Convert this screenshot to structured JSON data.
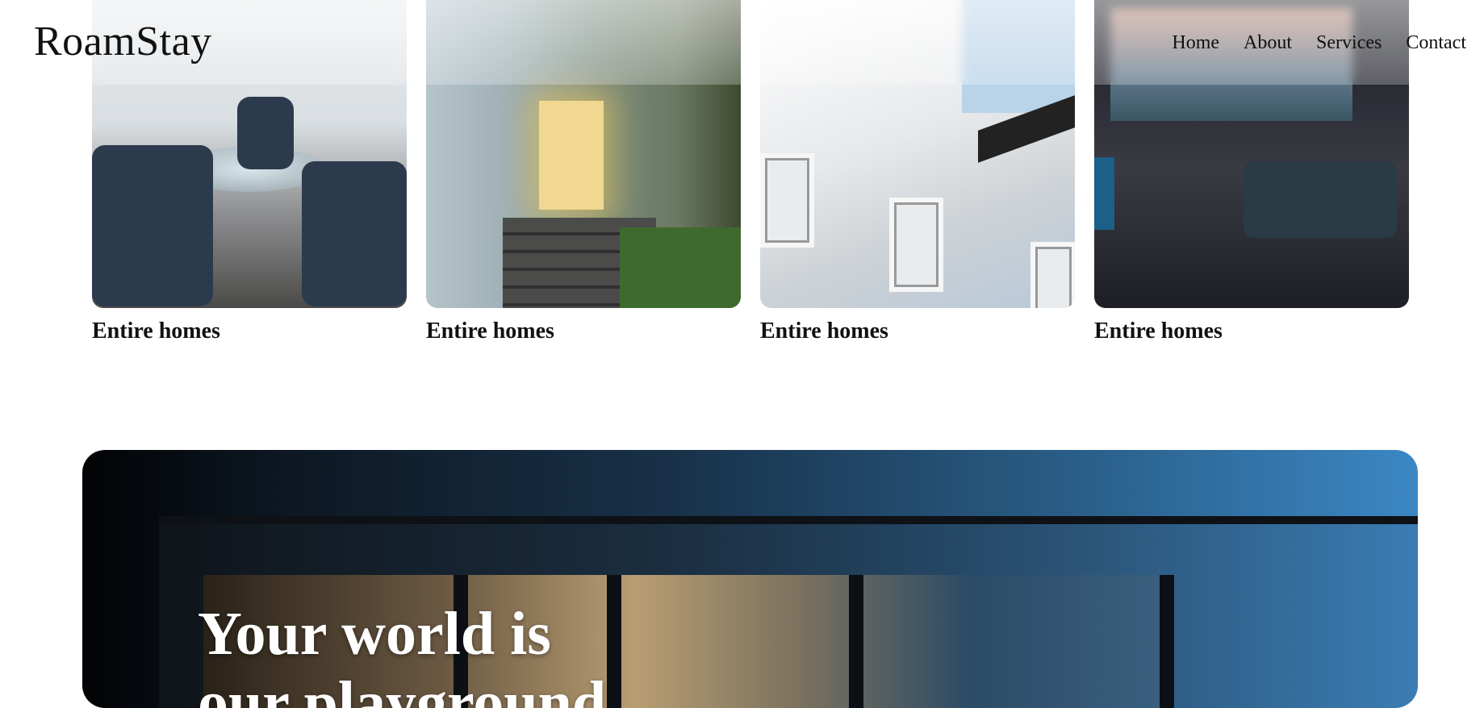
{
  "header": {
    "logo": "RoamStay",
    "nav": [
      "Home",
      "About",
      "Services",
      "Contact"
    ]
  },
  "cards": [
    {
      "title": "Entire homes"
    },
    {
      "title": "Entire homes"
    },
    {
      "title": "Entire homes"
    },
    {
      "title": "Entire homes"
    }
  ],
  "hero": {
    "title_line1": "Your world is",
    "title_line2": "our playground"
  },
  "colors": {
    "text": "#111111",
    "hero_gradient_start": "#020305",
    "hero_gradient_end": "#3b87c4",
    "hero_text": "#ffffff"
  }
}
